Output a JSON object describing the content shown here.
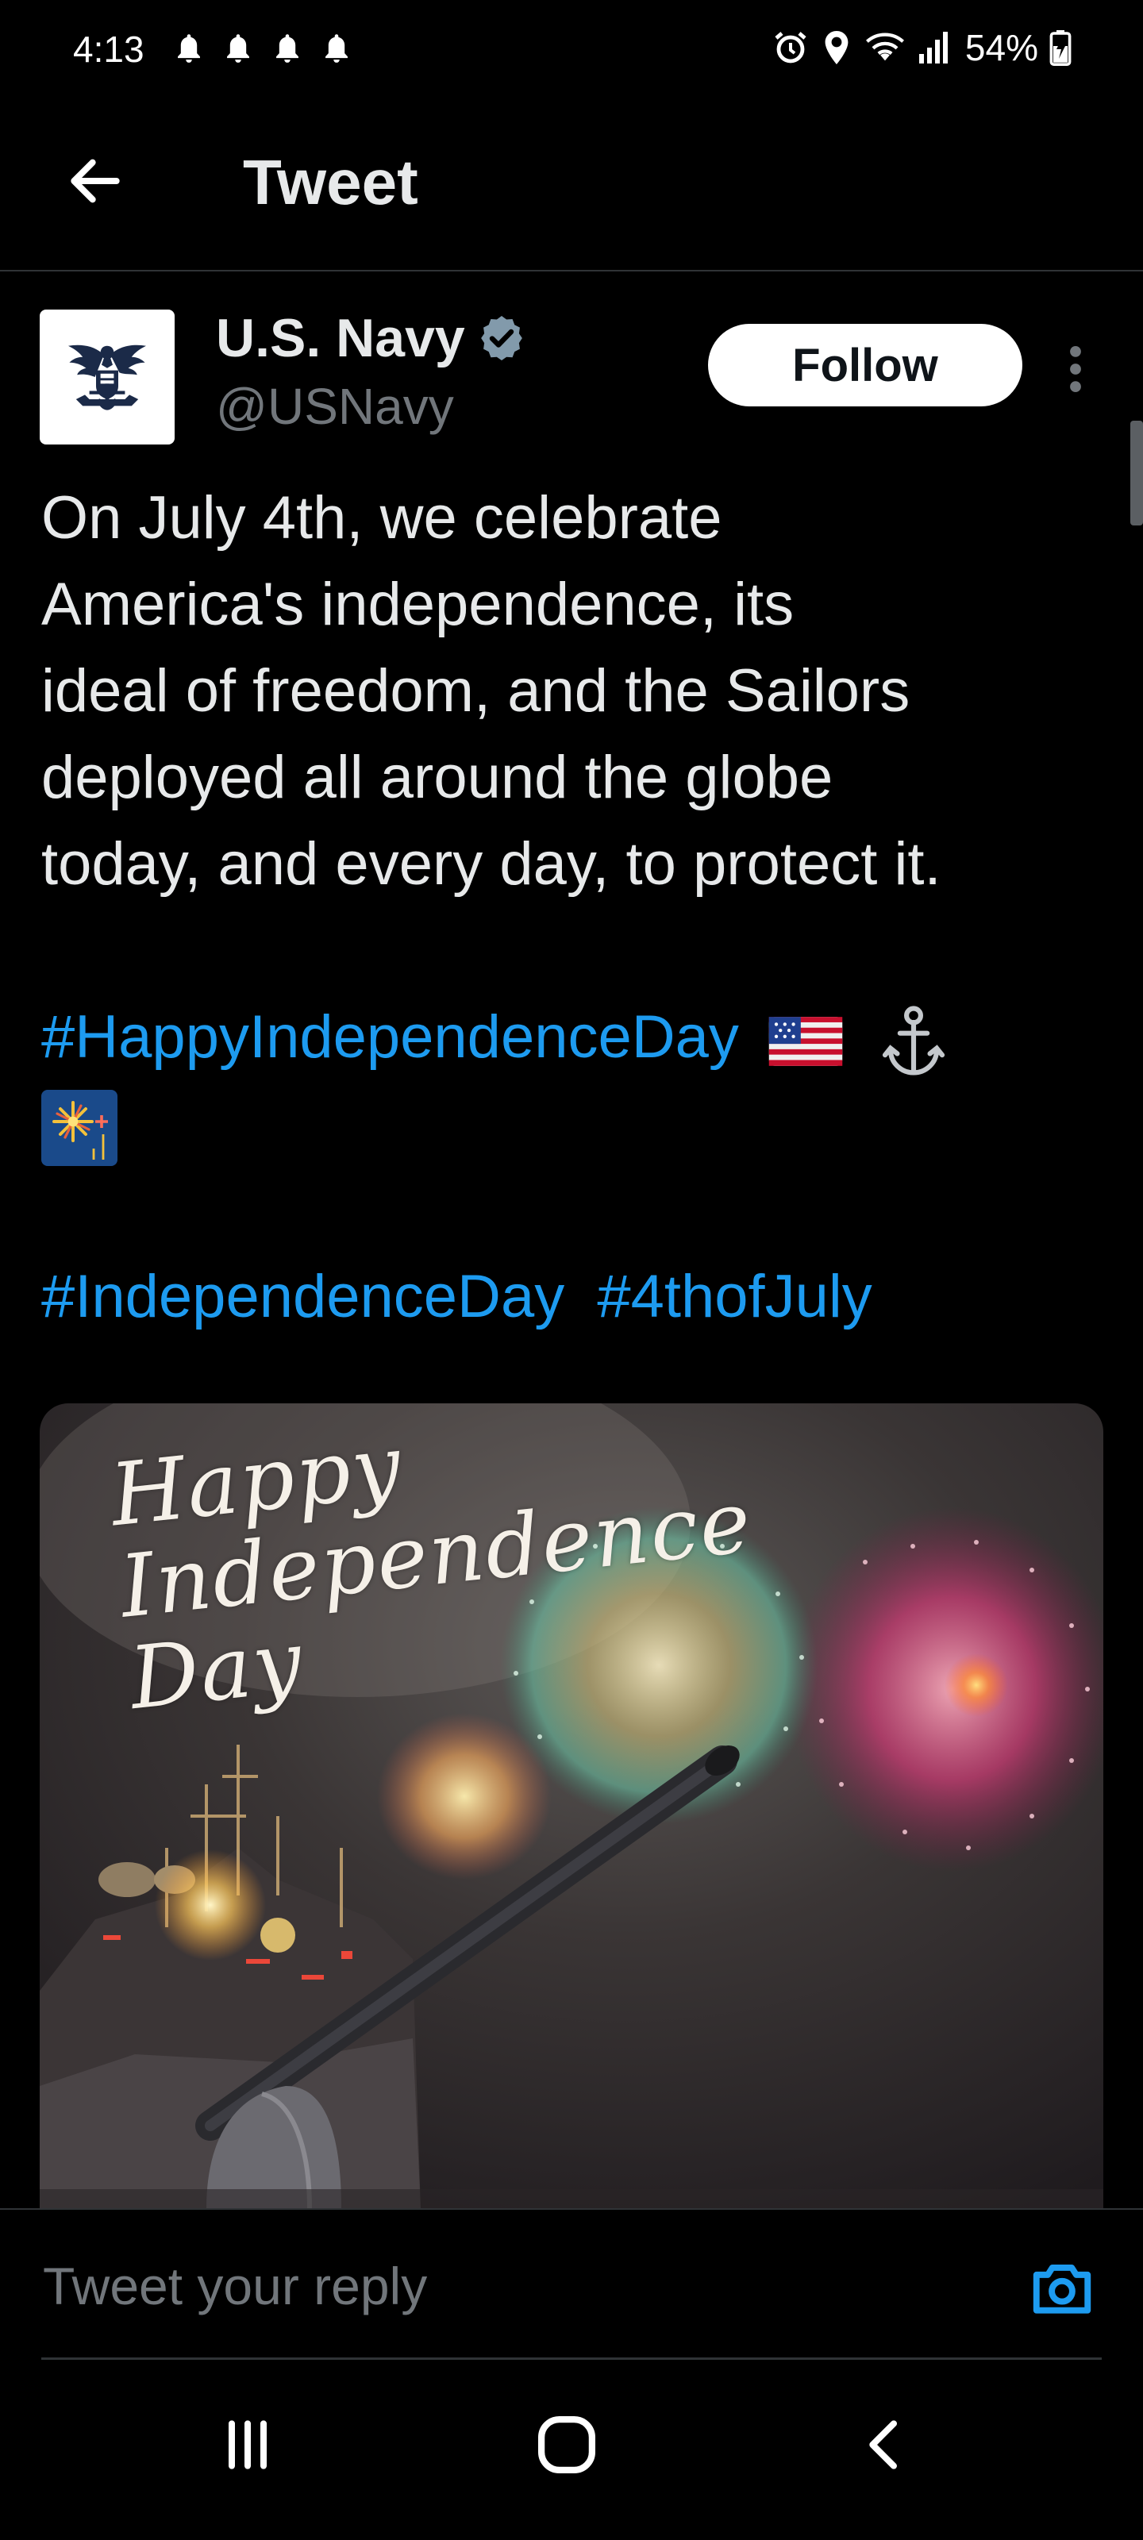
{
  "status_bar": {
    "time": "4:13",
    "battery": "54%",
    "notification_icons": [
      "bell-icon",
      "bell-icon",
      "bell-icon",
      "bell-icon"
    ],
    "right_icons": [
      "alarm-icon",
      "location-icon",
      "wifi-icon",
      "signal-icon",
      "battery-charging-icon"
    ]
  },
  "header": {
    "title": "Tweet",
    "back_icon": "arrow-left-icon"
  },
  "tweet": {
    "author_name": "U.S. Navy",
    "author_handle": "@USNavy",
    "verified": true,
    "follow_label": "Follow",
    "body_lines": [
      "On July 4th, we celebrate",
      "America's independence, its",
      "ideal of freedom, and the Sailors",
      "deployed all around the globe",
      "today, and every day, to protect it."
    ],
    "hashtag_1": "#HappyIndependenceDay",
    "emojis": [
      "us-flag",
      "anchor",
      "fireworks"
    ],
    "hashtag_2": "#IndependenceDay",
    "hashtag_3": "#4thofJuly",
    "media_caption_lines": [
      "Happy",
      "Independence",
      "Day"
    ]
  },
  "reply": {
    "placeholder": "Tweet your reply"
  },
  "colors": {
    "background": "#000000",
    "text": "#e7e9ea",
    "secondary_text": "#71767b",
    "link": "#1d9bf0",
    "divider": "#2f3336"
  },
  "nav_bar": {
    "buttons": [
      "recents-icon",
      "home-icon",
      "back-icon"
    ]
  }
}
